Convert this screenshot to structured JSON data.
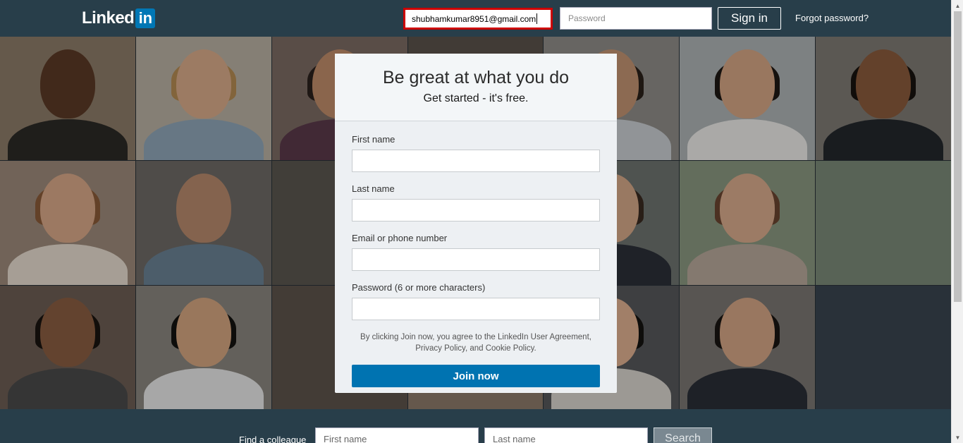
{
  "header": {
    "logo_text": "Linked",
    "logo_in": "in",
    "email_value": "shubhamkumar8951@gmail.com",
    "password_placeholder": "Password",
    "signin_label": "Sign in",
    "forgot_label": "Forgot password?"
  },
  "signup": {
    "headline": "Be great at what you do",
    "subhead": "Get started - it's free.",
    "first_name_label": "First name",
    "last_name_label": "Last name",
    "email_label": "Email or phone number",
    "password_label": "Password (6 or more characters)",
    "terms_text": "By clicking Join now, you agree to the LinkedIn User Agreement, Privacy Policy, and Cookie Policy.",
    "join_label": "Join now"
  },
  "find": {
    "label": "Find a colleague",
    "first_placeholder": "First name",
    "last_placeholder": "Last name",
    "search_label": "Search"
  },
  "colors": {
    "brand_blue": "#0077b5",
    "topbar": "#283e4a",
    "highlight_border": "#cc0000"
  }
}
